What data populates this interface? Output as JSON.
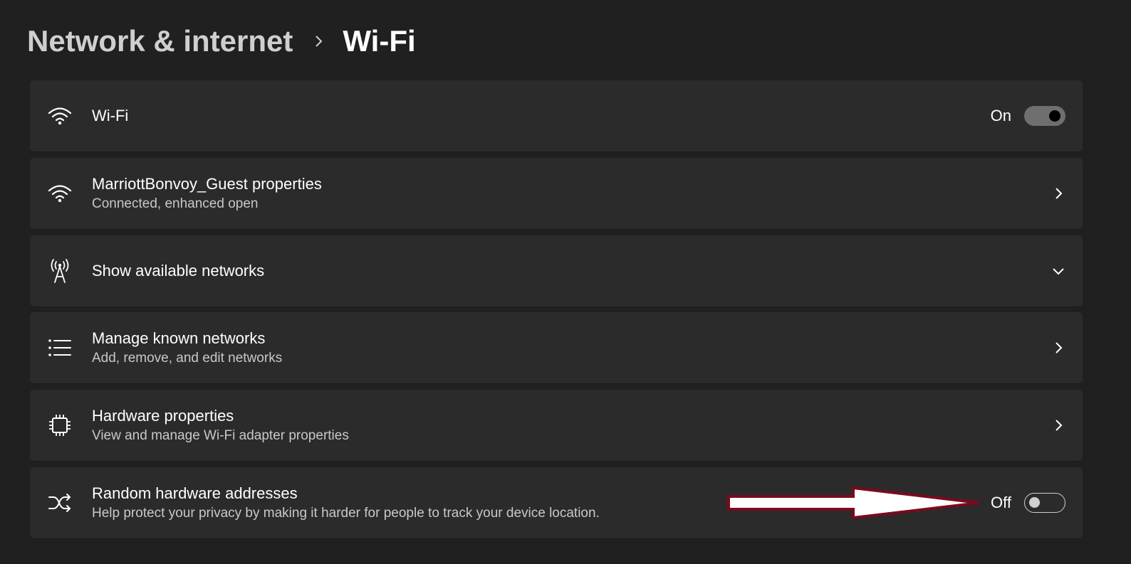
{
  "breadcrumb": {
    "parent": "Network & internet",
    "separator_icon": "chevron-right-icon",
    "current": "Wi-Fi"
  },
  "rows": [
    {
      "id": "wifi",
      "icon": "wifi-icon",
      "title": "Wi-Fi",
      "subtitle": "",
      "control": "toggle",
      "state_label": "On",
      "state": true
    },
    {
      "id": "network-properties",
      "icon": "wifi-icon",
      "title": "MarriottBonvoy_Guest properties",
      "subtitle": "Connected, enhanced open",
      "control": "chevron-right-icon"
    },
    {
      "id": "show-available",
      "icon": "antenna-icon",
      "title": "Show available networks",
      "subtitle": "",
      "control": "chevron-down-icon"
    },
    {
      "id": "manage-known",
      "icon": "list-icon",
      "title": "Manage known networks",
      "subtitle": "Add, remove, and edit networks",
      "control": "chevron-right-icon"
    },
    {
      "id": "hardware-properties",
      "icon": "chip-icon",
      "title": "Hardware properties",
      "subtitle": "View and manage Wi-Fi adapter properties",
      "control": "chevron-right-icon"
    },
    {
      "id": "random-hardware",
      "icon": "shuffle-icon",
      "title": "Random hardware addresses",
      "subtitle": "Help protect your privacy by making it harder for people to track your device location.",
      "control": "toggle",
      "state_label": "Off",
      "state": false
    }
  ],
  "colors": {
    "background": "#202020",
    "card": "#2b2b2b",
    "annotation_arrow_fill": "#ffffff",
    "annotation_arrow_stroke": "#7a0a1e"
  }
}
